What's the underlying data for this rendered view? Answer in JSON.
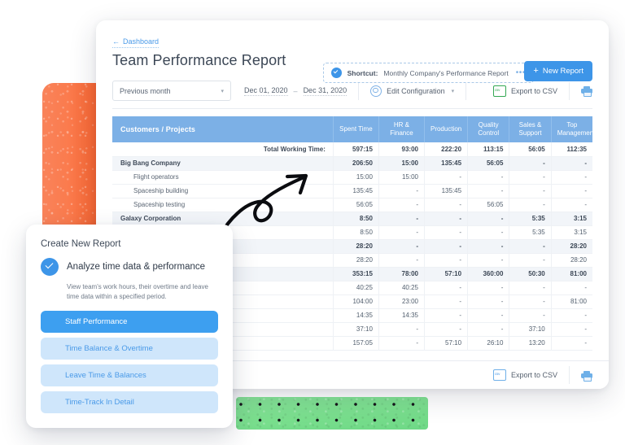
{
  "breadcrumb": {
    "label": "Dashboard",
    "icon": "arrow-left-icon"
  },
  "page_title": "Team Performance Report",
  "shortcut": {
    "label": "Shortcut:",
    "value": "Monthly Company's Performance Report",
    "more": "•••"
  },
  "new_report_button": {
    "label": "New Report",
    "plus": "+",
    "color": "#3d95e8"
  },
  "toolbar": {
    "period_select": {
      "value": "Previous month",
      "caret": "▾"
    },
    "date_from": "Dec 01, 2020",
    "date_dash": "–",
    "date_to": "Dec 31, 2020",
    "edit_configuration": "Edit Configuration",
    "edit_caret": "▾",
    "export_csv": "Export to CSV"
  },
  "footer": {
    "export_csv": "Export to CSV"
  },
  "table": {
    "columns": [
      "Customers / Projects",
      "Spent Time",
      "HR & Finance",
      "Production",
      "Quality Control",
      "Sales & Support",
      "Top Management"
    ],
    "rows": [
      {
        "type": "total",
        "name": "Total Working Time:",
        "values": [
          "597:15",
          "93:00",
          "222:20",
          "113:15",
          "56:05",
          "112:35"
        ]
      },
      {
        "type": "group",
        "name": "Big Bang Company",
        "values": [
          "206:50",
          "15:00",
          "135:45",
          "56:05",
          "-",
          "-"
        ]
      },
      {
        "type": "child",
        "name": "Flight operators",
        "values": [
          "15:00",
          "15:00",
          "-",
          "-",
          "-",
          "-"
        ]
      },
      {
        "type": "child",
        "name": "Spaceship building",
        "values": [
          "135:45",
          "-",
          "135:45",
          "-",
          "-",
          "-"
        ]
      },
      {
        "type": "child",
        "name": "Spaceship testing",
        "values": [
          "56:05",
          "-",
          "-",
          "56:05",
          "-",
          "-"
        ]
      },
      {
        "type": "group",
        "name": "Galaxy Corporation",
        "values": [
          "8:50",
          "-",
          "-",
          "-",
          "5:35",
          "3:15"
        ]
      },
      {
        "type": "child",
        "name": "",
        "values": [
          "8:50",
          "-",
          "-",
          "-",
          "5:35",
          "3:15"
        ]
      },
      {
        "type": "group",
        "name": "",
        "values": [
          "28:20",
          "-",
          "-",
          "-",
          "-",
          "28:20"
        ]
      },
      {
        "type": "child",
        "name": "",
        "values": [
          "28:20",
          "-",
          "-",
          "-",
          "-",
          "28:20"
        ]
      },
      {
        "type": "group",
        "name": "",
        "values": [
          "353:15",
          "78:00",
          "57:10",
          "360:00",
          "50:30",
          "81:00"
        ]
      },
      {
        "type": "child",
        "name": "",
        "values": [
          "40:25",
          "40:25",
          "-",
          "-",
          "-",
          "-"
        ]
      },
      {
        "type": "child",
        "name": "",
        "values": [
          "104:00",
          "23:00",
          "-",
          "-",
          "-",
          "81:00"
        ]
      },
      {
        "type": "child",
        "name": "",
        "values": [
          "14:35",
          "14:35",
          "-",
          "-",
          "-",
          "-"
        ]
      },
      {
        "type": "child",
        "name": "",
        "values": [
          "37:10",
          "-",
          "-",
          "-",
          "37:10",
          "-"
        ]
      },
      {
        "type": "child",
        "name": "",
        "values": [
          "157:05",
          "-",
          "57:10",
          "26:10",
          "13:20",
          "-"
        ]
      }
    ]
  },
  "card": {
    "title": "Create New Report",
    "option_title": "Analyze time data & performance",
    "description": "View team's work hours, their overtime and leave time data within a specified period.",
    "pills": [
      {
        "label": "Staff Performance",
        "active": true
      },
      {
        "label": "Time Balance & Overtime",
        "active": false
      },
      {
        "label": "Leave Time & Balances",
        "active": false
      },
      {
        "label": "Time-Track In Detail",
        "active": false
      }
    ]
  },
  "colors": {
    "accent": "#3d95e8",
    "table_header": "#7cb0e6",
    "pill_active": "#3d9ff0",
    "pill_idle": "#cfe6fb",
    "deco_orange": "#f8622c",
    "deco_green": "#7adf8e"
  }
}
